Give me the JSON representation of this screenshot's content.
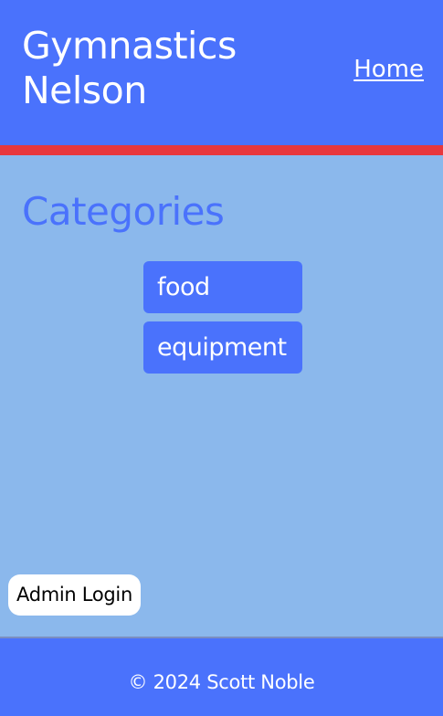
{
  "header": {
    "title": "Gymnastics Nelson",
    "nav_home": "Home"
  },
  "colors": {
    "primary_blue": "#4a72fc",
    "page_background": "#8bb8ec",
    "accent_red": "#e8373d",
    "text_on_primary": "#ffffff"
  },
  "main": {
    "heading": "Categories",
    "categories": [
      {
        "label": "food"
      },
      {
        "label": "equipment"
      }
    ],
    "admin_login_label": "Admin Login"
  },
  "footer": {
    "copyright": "© 2024 Scott Noble"
  }
}
